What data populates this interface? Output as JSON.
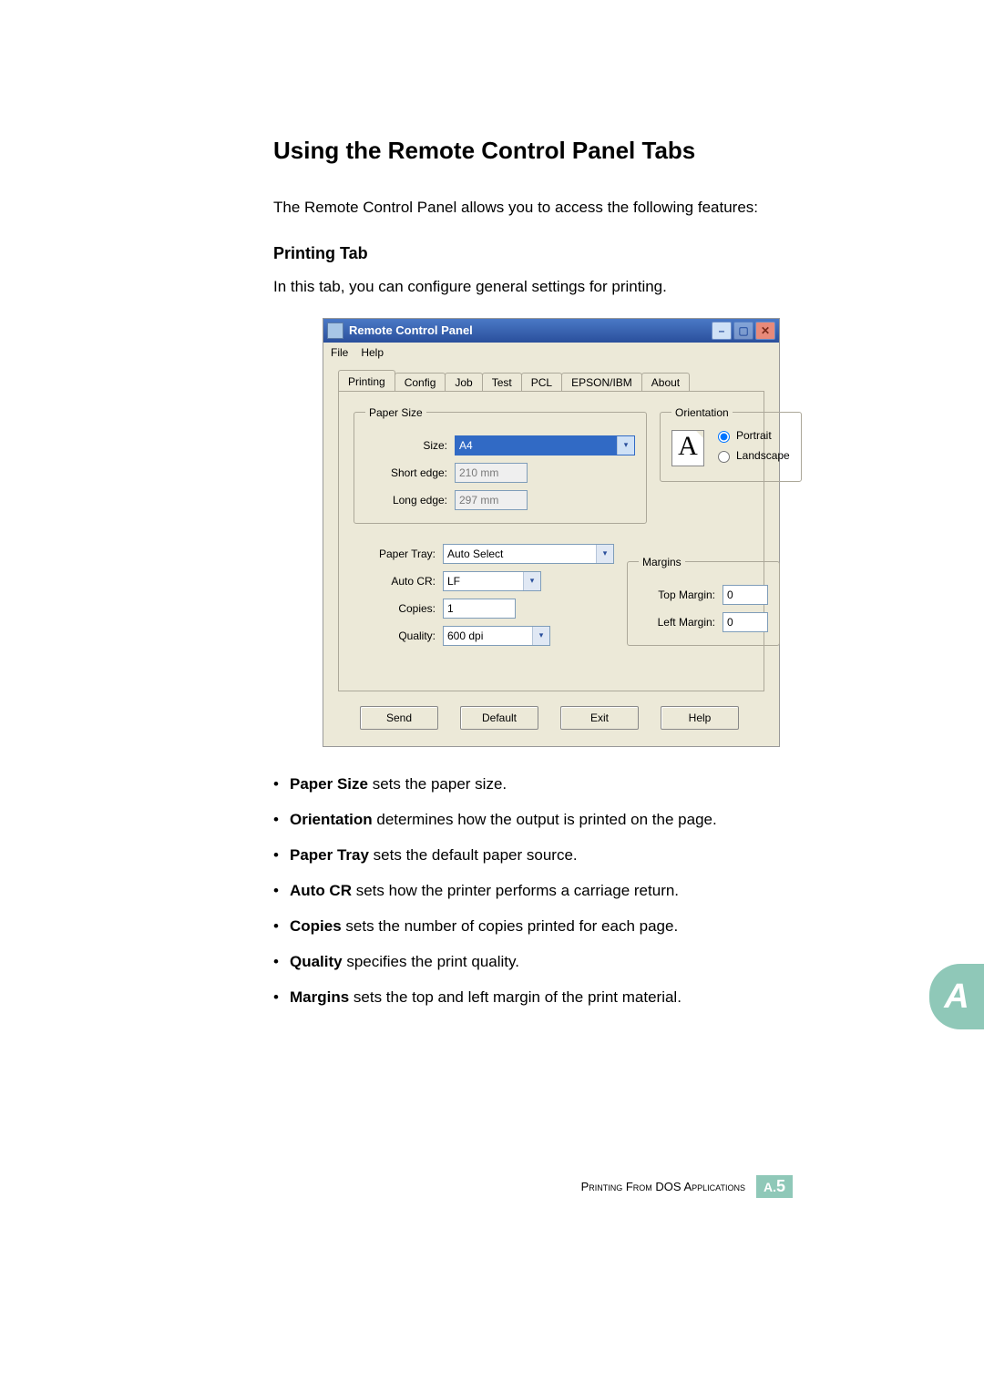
{
  "heading": "Using the Remote Control Panel Tabs",
  "intro": "The Remote Control Panel allows you to access the following features:",
  "subheading": "Printing Tab",
  "subintro": "In this tab, you can configure general settings for printing.",
  "dlg": {
    "title": "Remote Control Panel",
    "menu": {
      "file": "File",
      "help": "Help"
    },
    "tabs": {
      "printing": "Printing",
      "config": "Config",
      "job": "Job",
      "test": "Test",
      "pcl": "PCL",
      "epson": "EPSON/IBM",
      "about": "About"
    },
    "papersize_legend": "Paper Size",
    "size_label": "Size:",
    "size_value": "A4",
    "short_edge_label": "Short edge:",
    "short_edge_value": "210 mm",
    "long_edge_label": "Long edge:",
    "long_edge_value": "297 mm",
    "orientation_legend": "Orientation",
    "orientation_letter": "A",
    "portrait": "Portrait",
    "landscape": "Landscape",
    "paper_tray_label": "Paper Tray:",
    "paper_tray_value": "Auto Select",
    "auto_cr_label": "Auto CR:",
    "auto_cr_value": "LF",
    "copies_label": "Copies:",
    "copies_value": "1",
    "quality_label": "Quality:",
    "quality_value": "600 dpi",
    "margins_legend": "Margins",
    "top_margin_label": "Top Margin:",
    "top_margin_value": "0",
    "left_margin_label": "Left Margin:",
    "left_margin_value": "0",
    "buttons": {
      "send": "Send",
      "def": "Default",
      "exit": "Exit",
      "help": "Help"
    }
  },
  "bullets": {
    "b1_bold": "Paper Size",
    "b1_rest": " sets the paper size.",
    "b2_bold": "Orientation",
    "b2_rest": " determines how the output is printed on the page.",
    "b3_bold": "Paper Tray",
    "b3_rest": " sets the default paper source.",
    "b4_bold": "Auto CR",
    "b4_rest": " sets how the printer performs a carriage return.",
    "b5_bold": "Copies",
    "b5_rest": " sets the number of copies printed for each page.",
    "b6_bold": "Quality",
    "b6_rest": " specifies the print quality.",
    "b7_bold": "Margins",
    "b7_rest": " sets the top and left margin of the print material."
  },
  "pagetab_letter": "A",
  "footer": {
    "text": "Printing From DOS Applications",
    "pnum_prefix": "A.",
    "pnum_num": "5"
  }
}
